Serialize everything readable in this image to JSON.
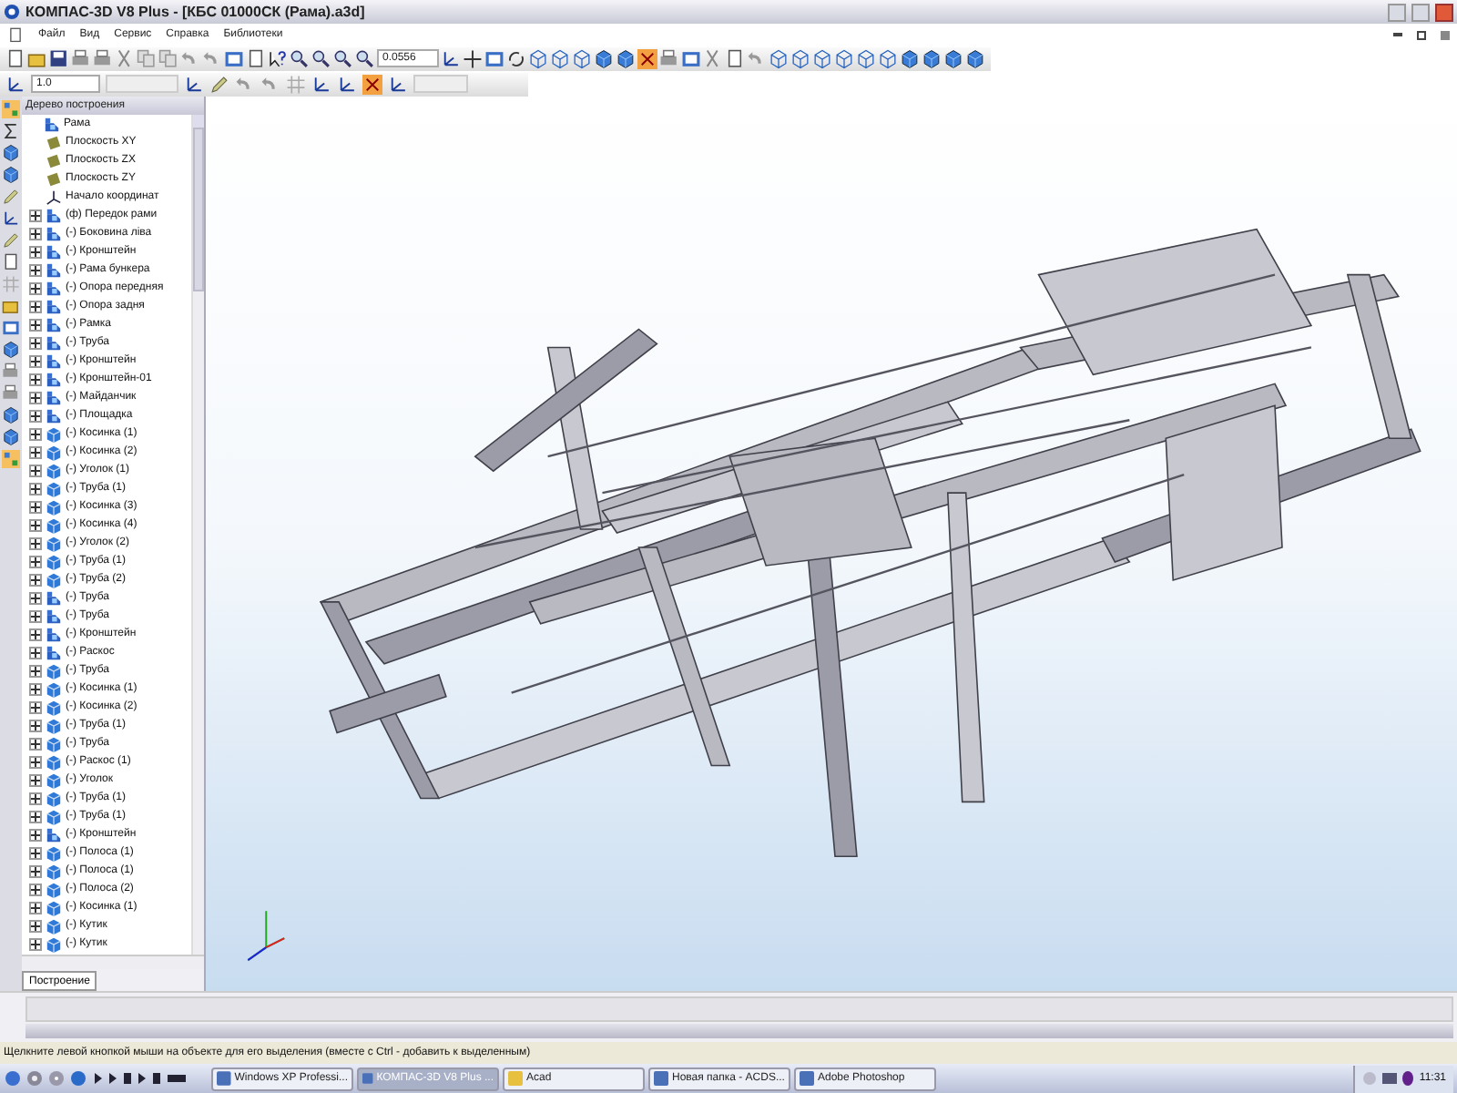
{
  "window": {
    "title": "КОМПАС-3D V8 Plus - [КБС 01000СК (Рама).a3d]"
  },
  "menu": [
    "Файл",
    "Вид",
    "Сервис",
    "Справка",
    "Библиотеки"
  ],
  "toolbar": {
    "zoom_value": "0.0556",
    "step_value": "1.0"
  },
  "tree": {
    "title": "Дерево построения",
    "root": {
      "label": "Рама",
      "expanded": true,
      "children": [
        {
          "label": "Плоскость XY",
          "kind": "plane"
        },
        {
          "label": "Плоскость ZX",
          "kind": "plane"
        },
        {
          "label": "Плоскость ZY",
          "kind": "plane"
        },
        {
          "label": "Начало координат",
          "kind": "origin"
        },
        {
          "label": "(ф) Передок рами",
          "kind": "assembly",
          "expanded": false
        },
        {
          "label": "(-) Боковина ліва",
          "kind": "assembly",
          "expanded": false
        },
        {
          "label": "(-) Кронштейн",
          "kind": "assembly",
          "expanded": false
        },
        {
          "label": "(-) Рама бункера",
          "kind": "assembly",
          "expanded": false
        },
        {
          "label": "(-) Опора передняя",
          "kind": "assembly",
          "expanded": false
        },
        {
          "label": "(-) Опора задня",
          "kind": "assembly",
          "expanded": false
        },
        {
          "label": "(-) Рамка",
          "kind": "assembly",
          "expanded": false
        },
        {
          "label": "(-) Труба",
          "kind": "assembly",
          "expanded": false
        },
        {
          "label": "(-) Кронштейн",
          "kind": "assembly",
          "expanded": false
        },
        {
          "label": "(-) Кронштейн-01",
          "kind": "assembly",
          "expanded": false
        },
        {
          "label": "(-) Майданчик",
          "kind": "assembly",
          "expanded": false
        },
        {
          "label": "(-) Площадка",
          "kind": "assembly",
          "expanded": false
        },
        {
          "label": "(-) Косинка (1)",
          "kind": "part",
          "expanded": false
        },
        {
          "label": "(-) Косинка (2)",
          "kind": "part",
          "expanded": false
        },
        {
          "label": "(-) Уголок (1)",
          "kind": "part",
          "expanded": false
        },
        {
          "label": "(-) Труба (1)",
          "kind": "part",
          "expanded": false
        },
        {
          "label": "(-) Косинка (3)",
          "kind": "part",
          "expanded": false
        },
        {
          "label": "(-) Косинка (4)",
          "kind": "part",
          "expanded": false
        },
        {
          "label": "(-) Уголок (2)",
          "kind": "part",
          "expanded": false
        },
        {
          "label": "(-) Труба (1)",
          "kind": "part",
          "expanded": false
        },
        {
          "label": "(-) Труба (2)",
          "kind": "part",
          "expanded": false
        },
        {
          "label": "(-) Труба",
          "kind": "assembly",
          "expanded": false
        },
        {
          "label": "(-) Труба",
          "kind": "assembly",
          "expanded": false
        },
        {
          "label": "(-) Кронштейн",
          "kind": "assembly",
          "expanded": false
        },
        {
          "label": "(-) Раскос",
          "kind": "assembly",
          "expanded": false
        },
        {
          "label": "(-) Труба",
          "kind": "part",
          "expanded": false
        },
        {
          "label": "(-) Косинка (1)",
          "kind": "part",
          "expanded": false
        },
        {
          "label": "(-) Косинка (2)",
          "kind": "part",
          "expanded": false
        },
        {
          "label": "(-) Труба (1)",
          "kind": "part",
          "expanded": false
        },
        {
          "label": "(-) Труба",
          "kind": "part",
          "expanded": false
        },
        {
          "label": "(-) Раскос (1)",
          "kind": "part",
          "expanded": false
        },
        {
          "label": "(-) Уголок",
          "kind": "part",
          "expanded": false
        },
        {
          "label": "(-) Труба (1)",
          "kind": "part",
          "expanded": false
        },
        {
          "label": "(-) Труба (1)",
          "kind": "part",
          "expanded": false
        },
        {
          "label": "(-) Кронштейн",
          "kind": "assembly",
          "expanded": false
        },
        {
          "label": "(-) Полоса (1)",
          "kind": "part",
          "expanded": false
        },
        {
          "label": "(-) Полоса (1)",
          "kind": "part",
          "expanded": false
        },
        {
          "label": "(-) Полоса (2)",
          "kind": "part",
          "expanded": false
        },
        {
          "label": "(-) Косинка (1)",
          "kind": "part",
          "expanded": false
        },
        {
          "label": "(-) Кутик",
          "kind": "part",
          "expanded": false
        },
        {
          "label": "(-) Кутик",
          "kind": "part",
          "expanded": false
        }
      ]
    }
  },
  "tree_tabs": [
    {
      "label": "Построение",
      "selected": true
    }
  ],
  "status_bar": "Щелкните левой кнопкой мыши на объекте для его выделения (вместе с Ctrl - добавить к выделенным)",
  "taskbar": {
    "buttons": [
      {
        "label": "Windows XP Professi...",
        "selected": false
      },
      {
        "label": "КОМПАС-3D V8 Plus ...",
        "selected": true
      },
      {
        "label": "Acad",
        "selected": false
      },
      {
        "label": "Новая папка - ACDS...",
        "selected": false
      },
      {
        "label": "Adobe Photoshop",
        "selected": false
      }
    ],
    "clock": "11:31"
  }
}
